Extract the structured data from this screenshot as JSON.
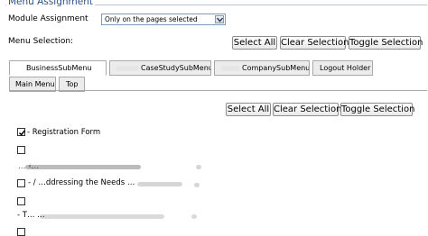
{
  "section": {
    "title": "Menu Assignment"
  },
  "module_assignment": {
    "label": "Module Assignment",
    "selected": "Only on the pages selected"
  },
  "menu_selection": {
    "label": "Menu Selection:",
    "buttons": {
      "select_all": "Select All",
      "clear": "Clear Selection",
      "toggle": "Toggle Selection"
    }
  },
  "tabs_row1": [
    {
      "label": "BusinessSubMenu"
    },
    {
      "label": "CaseStudySubMenu"
    },
    {
      "label": "CompanySubMenu"
    },
    {
      "label": "Logout Holder"
    }
  ],
  "tabs_row2": [
    {
      "label": "Main Menu"
    },
    {
      "label": "Top"
    }
  ],
  "panel_buttons": {
    "select_all": "Select All",
    "clear": "Clear Selection",
    "toggle": "Toggle Selection"
  },
  "items": [
    {
      "label": "- Registration Form",
      "checked": true
    },
    {
      "label": "",
      "checked": false
    },
    {
      "label": "… ‹…",
      "checked": false
    },
    {
      "label": "- /  …ddressing the Needs …",
      "checked": false
    },
    {
      "label": "",
      "checked": false
    },
    {
      "label": "- T… …",
      "checked": false
    },
    {
      "label": "",
      "checked": false
    }
  ]
}
